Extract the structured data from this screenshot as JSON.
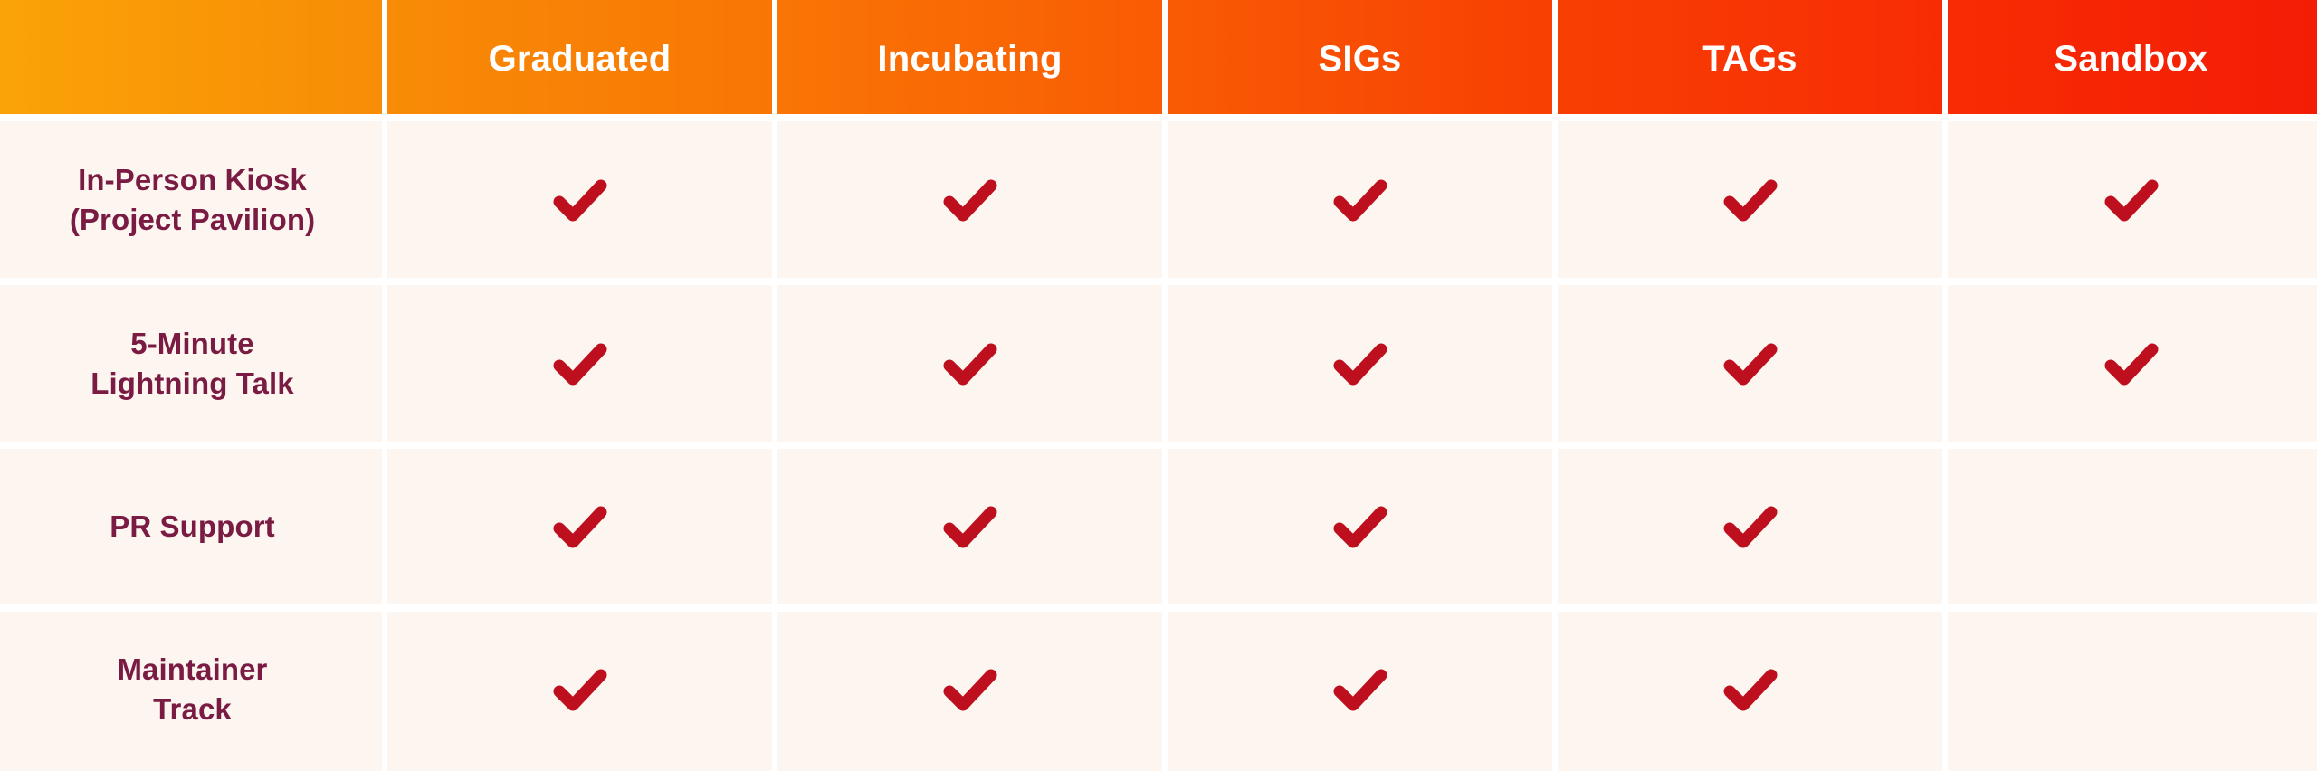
{
  "table": {
    "corner_label": "",
    "columns": [
      {
        "label": "Graduated"
      },
      {
        "label": "Incubating"
      },
      {
        "label": "SIGs"
      },
      {
        "label": "TAGs"
      },
      {
        "label": "Sandbox"
      }
    ],
    "rows": [
      {
        "label": "In-Person Kiosk\n(Project Pavilion)",
        "cells": [
          "check",
          "check",
          "check",
          "check",
          "check"
        ]
      },
      {
        "label": "5-Minute\nLightning Talk",
        "cells": [
          "check",
          "check",
          "check",
          "check",
          "check"
        ]
      },
      {
        "label": "PR Support",
        "cells": [
          "check",
          "check",
          "check",
          "check",
          ""
        ]
      },
      {
        "label": "Maintainer\nTrack",
        "cells": [
          "check",
          "check",
          "check",
          "check",
          ""
        ]
      }
    ],
    "icons": {
      "check": "check-icon"
    },
    "colors": {
      "header_gradient_start": "#FAA307",
      "header_gradient_end": "#F41C05",
      "cell_background": "#FDF5EF",
      "gridline": "#FFFFFF",
      "row_label_text": "#7A1B43",
      "header_text": "#FFFFFF",
      "check_mark": "#BE0F1E"
    }
  }
}
